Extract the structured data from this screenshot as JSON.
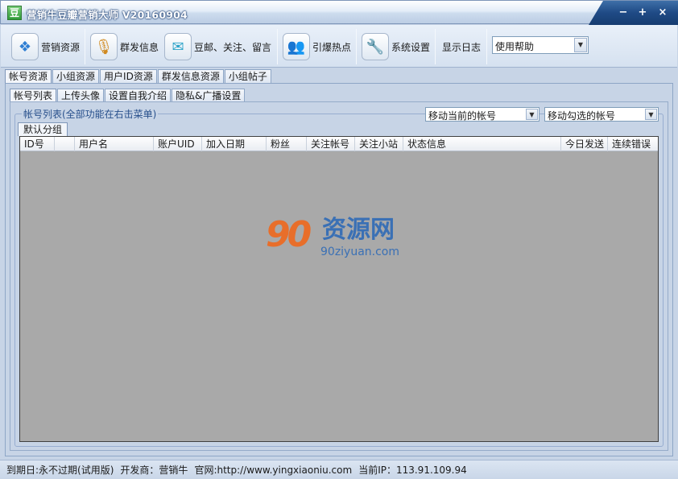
{
  "window": {
    "title": "营销牛豆瓣营销大师 V20160904",
    "icon_glyph": "豆",
    "controls": {
      "minimize": "−",
      "maximize": "+",
      "close": "×"
    }
  },
  "toolbar": {
    "items": [
      {
        "label": "营销资源",
        "icon": "dropbox-box-icon",
        "glyph": "❖"
      },
      {
        "label": "群发信息",
        "icon": "microphone-person-icon",
        "glyph": "🎙"
      },
      {
        "label": "豆邮、关注、留言",
        "icon": "envelope-icon",
        "glyph": "✉"
      },
      {
        "label": "引爆热点",
        "icon": "people-icon",
        "glyph": "👥"
      },
      {
        "label": "系统设置",
        "icon": "wrench-icon",
        "glyph": "🔧"
      },
      {
        "label": "显示日志"
      }
    ],
    "help_select": {
      "value": "使用帮助"
    }
  },
  "main_tabs": [
    "帐号资源",
    "小组资源",
    "用户ID资源",
    "群发信息资源",
    "小组帖子"
  ],
  "sub_tabs": [
    "帐号列表",
    "上传头像",
    "设置自我介绍",
    "隐私&广播设置"
  ],
  "account_list": {
    "group_label": "帐号列表(全部功能在右击菜单)",
    "move_current": "移动当前的帐号",
    "move_checked": "移动勾选的帐号",
    "group_tab": "默认分组",
    "columns": [
      "ID号",
      "",
      "用户名",
      "账户UID",
      "加入日期",
      "粉丝",
      "关注帐号",
      "关注小站",
      "状态信息",
      "今日发送",
      "连续错误"
    ]
  },
  "watermark": {
    "logo": "90",
    "text": "资源网",
    "url": "90ziyuan.com"
  },
  "statusbar": {
    "expiry": "到期日:永不过期(试用版)",
    "developer": "开发商：营销牛",
    "website": "官网:http://www.yingxiaoniu.com",
    "ip": "当前IP：113.91.109.94"
  },
  "colors": {
    "accent": "#28508c",
    "grid_background": "#a9a9a9",
    "window_background": "#c7d4e6",
    "watermark_orange": "#e86e2a",
    "watermark_blue": "#3a70b5"
  }
}
